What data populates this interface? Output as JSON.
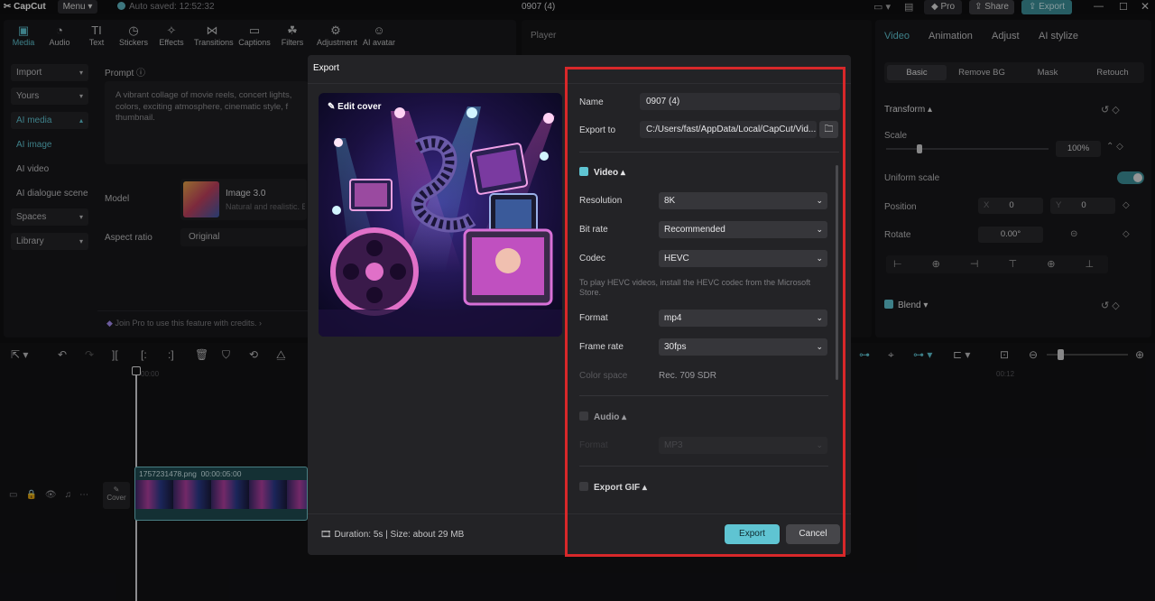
{
  "app": {
    "name": "CapCut",
    "menu": "Menu",
    "autosave": "Auto saved: 12:52:32",
    "project": "0907 (4)"
  },
  "topbar": {
    "pro": "Pro",
    "share": "Share",
    "export": "Export"
  },
  "toolbar": [
    {
      "label": "Media",
      "icon": "media-icon"
    },
    {
      "label": "Audio",
      "icon": "audio-icon"
    },
    {
      "label": "Text",
      "icon": "text-icon"
    },
    {
      "label": "Stickers",
      "icon": "stickers-icon"
    },
    {
      "label": "Effects",
      "icon": "effects-icon"
    },
    {
      "label": "Transitions",
      "icon": "transitions-icon"
    },
    {
      "label": "Captions",
      "icon": "captions-icon"
    },
    {
      "label": "Filters",
      "icon": "filters-icon"
    },
    {
      "label": "Adjustment",
      "icon": "adjustment-icon"
    },
    {
      "label": "AI avatar",
      "icon": "ai-avatar-icon"
    }
  ],
  "leftnav": [
    {
      "label": "Import"
    },
    {
      "label": "Yours"
    },
    {
      "label": "AI media"
    },
    {
      "label": "AI image"
    },
    {
      "label": "AI video"
    },
    {
      "label": "AI dialogue scene"
    },
    {
      "label": "Spaces"
    },
    {
      "label": "Library"
    }
  ],
  "prompt": {
    "label": "Prompt",
    "text": "A vibrant collage of movie reels, concert lights, colors, exciting atmosphere, cinematic style, f thumbnail.",
    "model_label": "Model",
    "model_name": "Image 3.0",
    "model_desc": "Natural and realistic. Excel...",
    "aspect_label": "Aspect ratio",
    "aspect_value": "Original",
    "join_pro": "Join Pro to use this feature with credits."
  },
  "player": {
    "title": "Player"
  },
  "right_panel": {
    "tabs": [
      "Video",
      "Animation",
      "Adjust",
      "AI stylize"
    ],
    "subtabs": [
      "Basic",
      "Remove BG",
      "Mask",
      "Retouch"
    ],
    "transform": "Transform",
    "scale": "Scale",
    "scale_value": "100%",
    "uniform_scale": "Uniform scale",
    "position": "Position",
    "pos_x_label": "X",
    "pos_x": "0",
    "pos_y_label": "Y",
    "pos_y": "0",
    "rotate": "Rotate",
    "rotate_value": "0.00°",
    "blend": "Blend"
  },
  "timeline": {
    "clip_name": "1757231478.png",
    "clip_duration": "00:00:05:00",
    "cover": "Cover",
    "time_start": "00:00",
    "time_mark": "00:12"
  },
  "export_dialog": {
    "title": "Export",
    "edit_cover": "Edit cover",
    "name_label": "Name",
    "name_value": "0907 (4)",
    "export_to_label": "Export to",
    "export_to_value": "C:/Users/fast/AppData/Local/CapCut/Vid...",
    "video_section": "Video",
    "resolution_label": "Resolution",
    "resolution_value": "8K",
    "bitrate_label": "Bit rate",
    "bitrate_value": "Recommended",
    "codec_label": "Codec",
    "codec_value": "HEVC",
    "hevc_note": "To play HEVC videos, install the HEVC codec from the Microsoft Store.",
    "format_label": "Format",
    "format_value": "mp4",
    "framerate_label": "Frame rate",
    "framerate_value": "30fps",
    "colorspace_label": "Color space",
    "colorspace_value": "Rec. 709 SDR",
    "audio_section": "Audio",
    "audio_format_label": "Format",
    "audio_format_value": "MP3",
    "gif_section": "Export GIF",
    "duration_size": "Duration: 5s | Size: about 29 MB",
    "export_button": "Export",
    "cancel_button": "Cancel"
  },
  "colors": {
    "accent": "#5fc4d2",
    "highlight": "#d8282a",
    "modal": "#232326"
  }
}
